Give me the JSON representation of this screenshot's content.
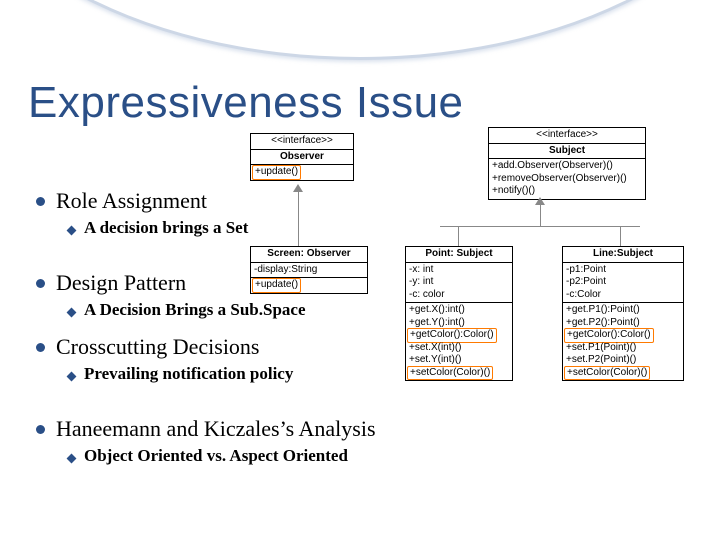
{
  "title": "Expressiveness Issue",
  "bullets": [
    {
      "label": "Role Assignment",
      "subs": [
        "A decision brings a Set"
      ]
    },
    {
      "label": "Design Pattern",
      "subs": [
        "A Decision Brings a Sub.Space"
      ]
    },
    {
      "label": "Crosscutting Decisions",
      "subs": [
        "Prevailing notification policy"
      ]
    },
    {
      "label": "Haneemann and Kiczales’s Analysis",
      "subs": [
        "Object Oriented vs. Aspect Oriented"
      ]
    }
  ],
  "uml": {
    "observer_iface": {
      "stereo": "<<interface>>",
      "name": "Observer",
      "ops": [
        "+update()"
      ]
    },
    "subject_iface": {
      "stereo": "<<interface>>",
      "name": "Subject",
      "ops": [
        "+add.Observer(Observer)()",
        "+removeObserver(Observer)()",
        "+notify()()"
      ]
    },
    "screen": {
      "name": "Screen: Observer",
      "attrs": [
        "-display:String"
      ],
      "ops": [
        "+update()"
      ]
    },
    "point": {
      "name": "Point: Subject",
      "attrs": [
        "-x: int",
        "-y: int",
        "-c: color"
      ],
      "ops": [
        "+get.X():int()",
        "+get.Y():int()",
        "+getColor():Color()",
        "+set.X(int)()",
        "+set.Y(int)()",
        "+setColor(Color)()"
      ],
      "hl": [
        "+getColor():Color()",
        "+setColor(Color)()"
      ]
    },
    "line": {
      "name": "Line:Subject",
      "attrs": [
        "-p1:Point",
        "-p2:Point",
        "-c:Color"
      ],
      "ops": [
        "+get.P1():Point()",
        "+get.P2():Point()",
        "+getColor():Color()",
        "+set.P1(Point)()",
        "+set.P2(Point)()",
        "+setColor(Color)()"
      ],
      "hl": [
        "+getColor():Color()",
        "+setColor(Color)()"
      ]
    }
  }
}
